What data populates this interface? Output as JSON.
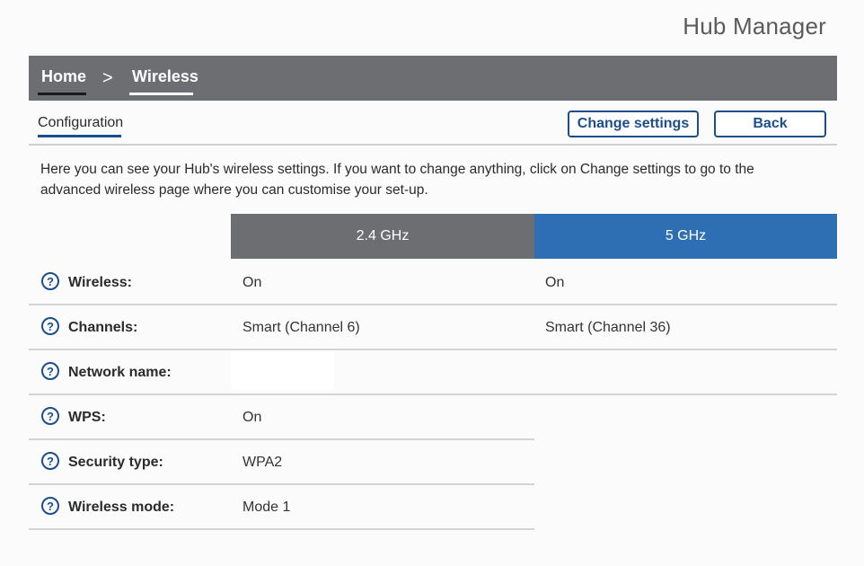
{
  "app_title": "Hub Manager",
  "breadcrumb": {
    "home": "Home",
    "separator": ">",
    "current": "Wireless"
  },
  "subnav": {
    "tab": "Configuration"
  },
  "actions": {
    "change_settings": "Change settings",
    "back": "Back"
  },
  "intro": "Here you can see your Hub's wireless settings. If you want to change anything, click on Change settings to go to the advanced wireless page where you can customise your set-up.",
  "bands": {
    "b24": "2.4 GHz",
    "b5": "5 GHz"
  },
  "help_glyph": "?",
  "rows": [
    {
      "label": "Wireless:",
      "v24": "On",
      "v5": "On"
    },
    {
      "label": "Channels:",
      "v24": "Smart (Channel 6)",
      "v5": "Smart (Channel 36)"
    },
    {
      "label": "Network name:",
      "v24": "",
      "v5": ""
    },
    {
      "label": "WPS:",
      "v24": "On"
    },
    {
      "label": "Security type:",
      "v24": "WPA2"
    },
    {
      "label": "Wireless mode:",
      "v24": "Mode 1"
    }
  ],
  "colors": {
    "nav": "#6d6e71",
    "accent": "#1c4e8b",
    "band5": "#2e6fb3"
  }
}
